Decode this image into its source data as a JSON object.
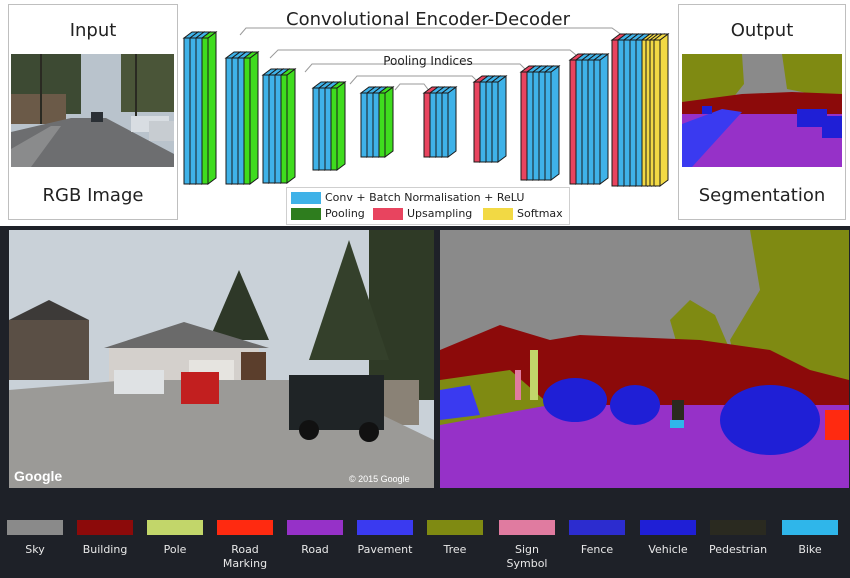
{
  "figure": {
    "title": "Convolutional Encoder-Decoder",
    "pooling_indices_label": "Pooling Indices",
    "input": {
      "title": "Input",
      "caption": "RGB Image"
    },
    "output": {
      "title": "Output",
      "caption": "Segmentation"
    }
  },
  "legend": [
    {
      "label": "Conv + Batch Normalisation + ReLU",
      "color": "#3fb2e8"
    },
    {
      "label": "Pooling",
      "color": "#2e7d1e"
    },
    {
      "label": "Upsampling",
      "color": "#e8445f"
    },
    {
      "label": "Softmax",
      "color": "#f2d944"
    }
  ],
  "layer_colors": {
    "conv": "#3fb2e8",
    "pool": "#3fdc1e",
    "upsample": "#e8445f",
    "softmax": "#f2d944"
  },
  "photo_credits": {
    "brand": "Google",
    "copyright": "© 2015 Google"
  },
  "classes": [
    {
      "label": "Sky",
      "color": "#8a8a8a"
    },
    {
      "label": "Building",
      "color": "#8c0a0a"
    },
    {
      "label": "Pole",
      "color": "#c2d66a"
    },
    {
      "label": "Road",
      "label2": "Marking",
      "color": "#ff2a10"
    },
    {
      "label": "Road",
      "color": "#9631c8"
    },
    {
      "label": "Pavement",
      "color": "#3a3af0"
    },
    {
      "label": "Tree",
      "color": "#7f8a12"
    },
    {
      "label": "Sign",
      "label2": "Symbol",
      "color": "#e07ba0"
    },
    {
      "label": "Fence",
      "color": "#2c2ccf"
    },
    {
      "label": "Vehicle",
      "color": "#1f1fd6"
    },
    {
      "label": "Pedestrian",
      "color": "#2a2a20"
    },
    {
      "label": "Bike",
      "color": "#2fb6ea"
    }
  ]
}
